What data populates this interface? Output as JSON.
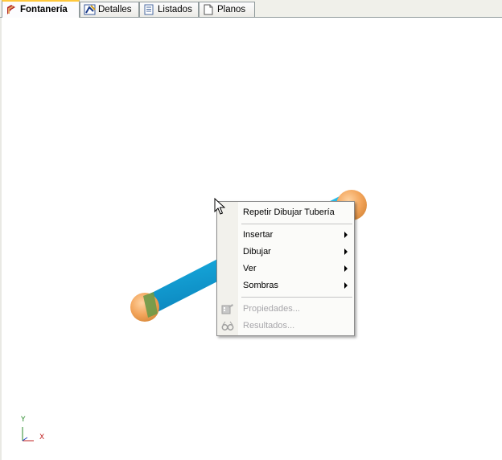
{
  "tabs": [
    {
      "label": "Fontanería",
      "icon": "fontaneria-icon",
      "active": true
    },
    {
      "label": "Detalles",
      "icon": "detalles-icon",
      "active": false
    },
    {
      "label": "Listados",
      "icon": "listados-icon",
      "active": false
    },
    {
      "label": "Planos",
      "icon": "planos-icon",
      "active": false
    }
  ],
  "context_menu": {
    "items": [
      {
        "label": "Repetir Dibujar Tubería",
        "submenu": false,
        "enabled": true
      },
      {
        "label": "Insertar",
        "submenu": true,
        "enabled": true
      },
      {
        "label": "Dibujar",
        "submenu": true,
        "enabled": true
      },
      {
        "label": "Ver",
        "submenu": true,
        "enabled": true
      },
      {
        "label": "Sombras",
        "submenu": true,
        "enabled": true
      },
      {
        "label": "Propiedades...",
        "submenu": false,
        "enabled": false,
        "icon": "properties-icon"
      },
      {
        "label": "Resultados...",
        "submenu": false,
        "enabled": false,
        "icon": "glasses-icon"
      }
    ]
  },
  "axes": {
    "y_label": "Y",
    "x_label": "X"
  },
  "colors": {
    "pipe": "#1ab7e8",
    "node": "#f0a050",
    "fitting": "#6a9a40",
    "tab_highlight": "#ffc83c"
  }
}
